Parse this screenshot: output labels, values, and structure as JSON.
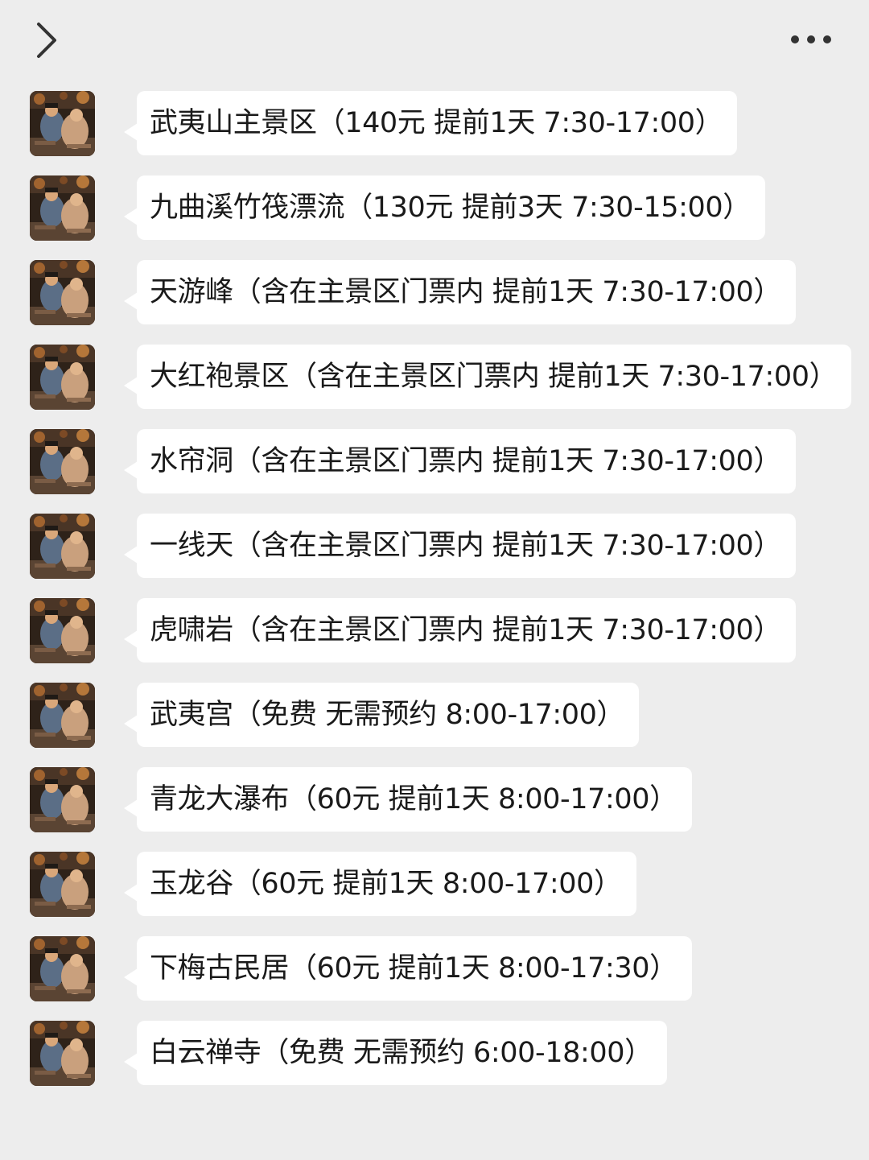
{
  "header": {
    "back_icon": "chevron-left-icon",
    "more_icon": "more-dots-icon"
  },
  "colors": {
    "background": "#ededed",
    "bubble": "#ffffff",
    "text": "#1a1a1a",
    "icon": "#333333"
  },
  "messages": [
    {
      "text": "武夷山主景区（140元 提前1天 7:30-17:00）"
    },
    {
      "text": "九曲溪竹筏漂流（130元 提前3天 7:30-15:00）"
    },
    {
      "text": "天游峰（含在主景区门票内 提前1天 7:30-17:00）"
    },
    {
      "text": "大红袍景区（含在主景区门票内 提前1天 7:30-17:00）"
    },
    {
      "text": "水帘洞（含在主景区门票内 提前1天 7:30-17:00）"
    },
    {
      "text": "一线天（含在主景区门票内 提前1天 7:30-17:00）"
    },
    {
      "text": "虎啸岩（含在主景区门票内 提前1天 7:30-17:00）"
    },
    {
      "text": "武夷宫（免费 无需预约 8:00-17:00）"
    },
    {
      "text": "青龙大瀑布（60元 提前1天 8:00-17:00）"
    },
    {
      "text": "玉龙谷（60元 提前1天 8:00-17:00）"
    },
    {
      "text": "下梅古民居（60元 提前1天 8:00-17:30）"
    },
    {
      "text": "白云禅寺（免费 无需预约 6:00-18:00）"
    }
  ]
}
